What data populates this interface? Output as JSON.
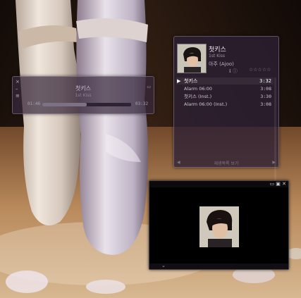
{
  "mini_player": {
    "title": "첫키스",
    "subtitle": "1st Kiss",
    "elapsed": "01:46",
    "total": "03:32",
    "progress": 0.5
  },
  "playlist": {
    "now_playing": {
      "title": "첫키스",
      "subtitle": "1st Kiss",
      "artist": "아주 (Ajoo)",
      "rating_stars": "☆☆☆☆☆"
    },
    "tracks": [
      {
        "title": "첫키스",
        "duration": "3:32",
        "playing": true
      },
      {
        "title": "Alarm 06:00",
        "duration": "3:08",
        "playing": false
      },
      {
        "title": "첫키스 (Inst.)",
        "duration": "3:30",
        "playing": false
      },
      {
        "title": "Alarm 06:00 (Inst.)",
        "duration": "3:08",
        "playing": false
      }
    ],
    "footer_label": "재생목록 보기"
  },
  "colors": {
    "panel": "#2d2034",
    "accent": "#f0e8f2"
  }
}
